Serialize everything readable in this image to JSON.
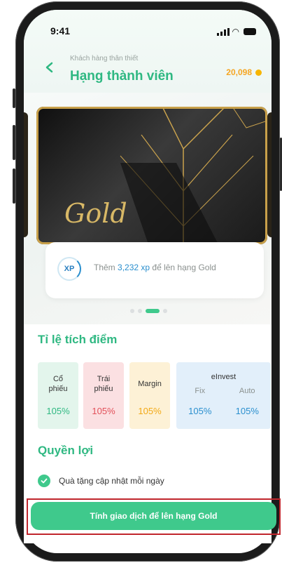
{
  "status_bar": {
    "time": "9:41"
  },
  "header": {
    "subtitle": "Khách hàng thân thiết",
    "title": "Hạng thành viên",
    "points": "20,098"
  },
  "card": {
    "tier_name": "Gold"
  },
  "xp": {
    "badge": "XP",
    "text_prefix": "Thêm ",
    "amount": "3,232 xp",
    "text_suffix": " để lên hạng Gold"
  },
  "carousel": {
    "count": 4,
    "active_index": 2
  },
  "rates": {
    "title": "Tỉ lệ tích điểm",
    "co_phieu": {
      "label_line1": "Cổ",
      "label_line2": "phiếu",
      "value": "105%"
    },
    "trai_phieu": {
      "label_line1": "Trái",
      "label_line2": "phiếu",
      "value": "105%"
    },
    "margin": {
      "label": "Margin",
      "value": "105%"
    },
    "einvest": {
      "label": "eInvest",
      "fix_label": "Fix",
      "fix_value": "105%",
      "auto_label": "Auto",
      "auto_value": "105%"
    }
  },
  "benefits": {
    "title": "Quyền lợi",
    "items": [
      {
        "label": "Quà tặng cập nhật mỗi ngày"
      }
    ]
  },
  "cta": {
    "label": "Tính giao dịch để lên hạng Gold"
  },
  "colors": {
    "accent": "#2fb882",
    "button": "#3fc98c",
    "points": "#f5a623",
    "xp_highlight": "#2a8fce",
    "highlight_border": "#c0262d"
  }
}
